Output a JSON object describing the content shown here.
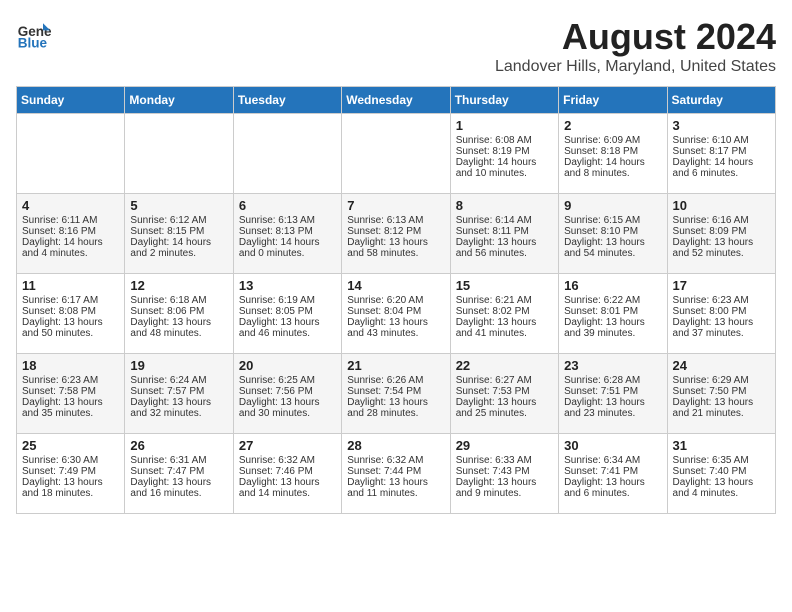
{
  "header": {
    "logo_line1": "General",
    "logo_line2": "Blue",
    "month_year": "August 2024",
    "location": "Landover Hills, Maryland, United States"
  },
  "days_of_week": [
    "Sunday",
    "Monday",
    "Tuesday",
    "Wednesday",
    "Thursday",
    "Friday",
    "Saturday"
  ],
  "weeks": [
    [
      {
        "day": "",
        "sunrise": "",
        "sunset": "",
        "daylight": ""
      },
      {
        "day": "",
        "sunrise": "",
        "sunset": "",
        "daylight": ""
      },
      {
        "day": "",
        "sunrise": "",
        "sunset": "",
        "daylight": ""
      },
      {
        "day": "",
        "sunrise": "",
        "sunset": "",
        "daylight": ""
      },
      {
        "day": "1",
        "sunrise": "Sunrise: 6:08 AM",
        "sunset": "Sunset: 8:19 PM",
        "daylight": "Daylight: 14 hours and 10 minutes."
      },
      {
        "day": "2",
        "sunrise": "Sunrise: 6:09 AM",
        "sunset": "Sunset: 8:18 PM",
        "daylight": "Daylight: 14 hours and 8 minutes."
      },
      {
        "day": "3",
        "sunrise": "Sunrise: 6:10 AM",
        "sunset": "Sunset: 8:17 PM",
        "daylight": "Daylight: 14 hours and 6 minutes."
      }
    ],
    [
      {
        "day": "4",
        "sunrise": "Sunrise: 6:11 AM",
        "sunset": "Sunset: 8:16 PM",
        "daylight": "Daylight: 14 hours and 4 minutes."
      },
      {
        "day": "5",
        "sunrise": "Sunrise: 6:12 AM",
        "sunset": "Sunset: 8:15 PM",
        "daylight": "Daylight: 14 hours and 2 minutes."
      },
      {
        "day": "6",
        "sunrise": "Sunrise: 6:13 AM",
        "sunset": "Sunset: 8:13 PM",
        "daylight": "Daylight: 14 hours and 0 minutes."
      },
      {
        "day": "7",
        "sunrise": "Sunrise: 6:13 AM",
        "sunset": "Sunset: 8:12 PM",
        "daylight": "Daylight: 13 hours and 58 minutes."
      },
      {
        "day": "8",
        "sunrise": "Sunrise: 6:14 AM",
        "sunset": "Sunset: 8:11 PM",
        "daylight": "Daylight: 13 hours and 56 minutes."
      },
      {
        "day": "9",
        "sunrise": "Sunrise: 6:15 AM",
        "sunset": "Sunset: 8:10 PM",
        "daylight": "Daylight: 13 hours and 54 minutes."
      },
      {
        "day": "10",
        "sunrise": "Sunrise: 6:16 AM",
        "sunset": "Sunset: 8:09 PM",
        "daylight": "Daylight: 13 hours and 52 minutes."
      }
    ],
    [
      {
        "day": "11",
        "sunrise": "Sunrise: 6:17 AM",
        "sunset": "Sunset: 8:08 PM",
        "daylight": "Daylight: 13 hours and 50 minutes."
      },
      {
        "day": "12",
        "sunrise": "Sunrise: 6:18 AM",
        "sunset": "Sunset: 8:06 PM",
        "daylight": "Daylight: 13 hours and 48 minutes."
      },
      {
        "day": "13",
        "sunrise": "Sunrise: 6:19 AM",
        "sunset": "Sunset: 8:05 PM",
        "daylight": "Daylight: 13 hours and 46 minutes."
      },
      {
        "day": "14",
        "sunrise": "Sunrise: 6:20 AM",
        "sunset": "Sunset: 8:04 PM",
        "daylight": "Daylight: 13 hours and 43 minutes."
      },
      {
        "day": "15",
        "sunrise": "Sunrise: 6:21 AM",
        "sunset": "Sunset: 8:02 PM",
        "daylight": "Daylight: 13 hours and 41 minutes."
      },
      {
        "day": "16",
        "sunrise": "Sunrise: 6:22 AM",
        "sunset": "Sunset: 8:01 PM",
        "daylight": "Daylight: 13 hours and 39 minutes."
      },
      {
        "day": "17",
        "sunrise": "Sunrise: 6:23 AM",
        "sunset": "Sunset: 8:00 PM",
        "daylight": "Daylight: 13 hours and 37 minutes."
      }
    ],
    [
      {
        "day": "18",
        "sunrise": "Sunrise: 6:23 AM",
        "sunset": "Sunset: 7:58 PM",
        "daylight": "Daylight: 13 hours and 35 minutes."
      },
      {
        "day": "19",
        "sunrise": "Sunrise: 6:24 AM",
        "sunset": "Sunset: 7:57 PM",
        "daylight": "Daylight: 13 hours and 32 minutes."
      },
      {
        "day": "20",
        "sunrise": "Sunrise: 6:25 AM",
        "sunset": "Sunset: 7:56 PM",
        "daylight": "Daylight: 13 hours and 30 minutes."
      },
      {
        "day": "21",
        "sunrise": "Sunrise: 6:26 AM",
        "sunset": "Sunset: 7:54 PM",
        "daylight": "Daylight: 13 hours and 28 minutes."
      },
      {
        "day": "22",
        "sunrise": "Sunrise: 6:27 AM",
        "sunset": "Sunset: 7:53 PM",
        "daylight": "Daylight: 13 hours and 25 minutes."
      },
      {
        "day": "23",
        "sunrise": "Sunrise: 6:28 AM",
        "sunset": "Sunset: 7:51 PM",
        "daylight": "Daylight: 13 hours and 23 minutes."
      },
      {
        "day": "24",
        "sunrise": "Sunrise: 6:29 AM",
        "sunset": "Sunset: 7:50 PM",
        "daylight": "Daylight: 13 hours and 21 minutes."
      }
    ],
    [
      {
        "day": "25",
        "sunrise": "Sunrise: 6:30 AM",
        "sunset": "Sunset: 7:49 PM",
        "daylight": "Daylight: 13 hours and 18 minutes."
      },
      {
        "day": "26",
        "sunrise": "Sunrise: 6:31 AM",
        "sunset": "Sunset: 7:47 PM",
        "daylight": "Daylight: 13 hours and 16 minutes."
      },
      {
        "day": "27",
        "sunrise": "Sunrise: 6:32 AM",
        "sunset": "Sunset: 7:46 PM",
        "daylight": "Daylight: 13 hours and 14 minutes."
      },
      {
        "day": "28",
        "sunrise": "Sunrise: 6:32 AM",
        "sunset": "Sunset: 7:44 PM",
        "daylight": "Daylight: 13 hours and 11 minutes."
      },
      {
        "day": "29",
        "sunrise": "Sunrise: 6:33 AM",
        "sunset": "Sunset: 7:43 PM",
        "daylight": "Daylight: 13 hours and 9 minutes."
      },
      {
        "day": "30",
        "sunrise": "Sunrise: 6:34 AM",
        "sunset": "Sunset: 7:41 PM",
        "daylight": "Daylight: 13 hours and 6 minutes."
      },
      {
        "day": "31",
        "sunrise": "Sunrise: 6:35 AM",
        "sunset": "Sunset: 7:40 PM",
        "daylight": "Daylight: 13 hours and 4 minutes."
      }
    ]
  ]
}
